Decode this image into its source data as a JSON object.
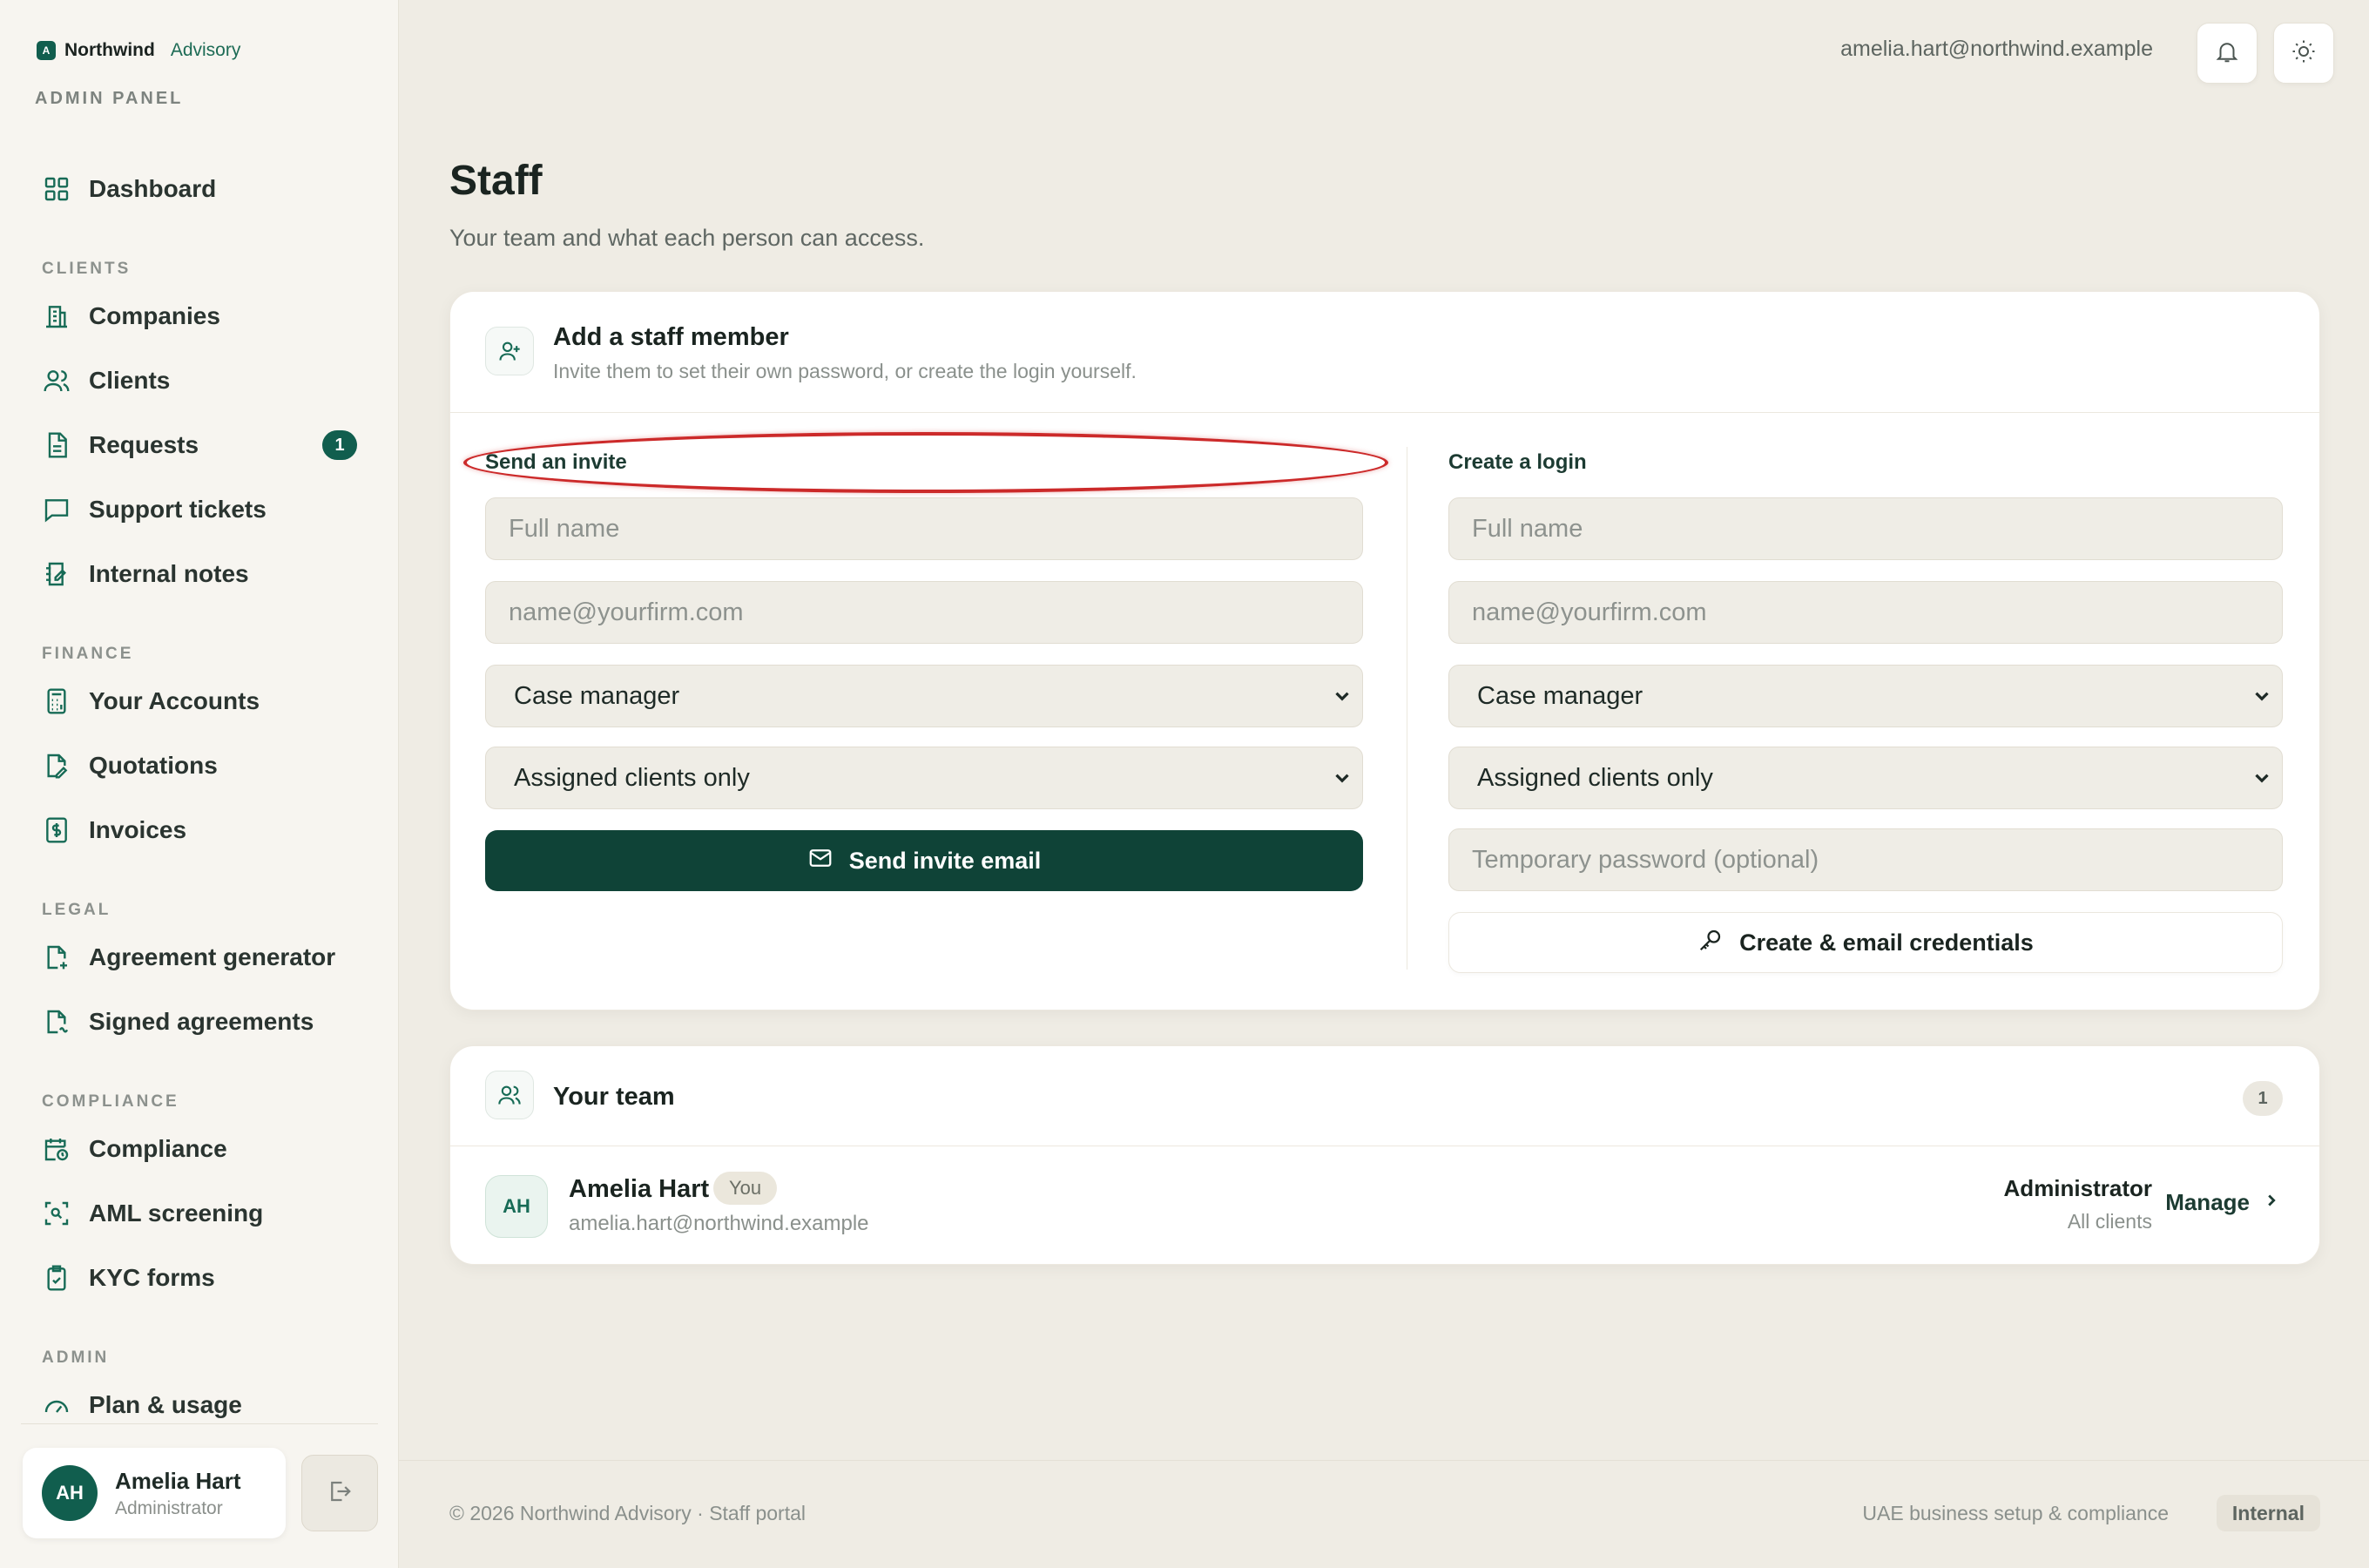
{
  "brand": {
    "mark": "A",
    "name": "Northwind",
    "sub": "Advisory",
    "panel": "ADMIN PANEL"
  },
  "nav": {
    "dashboard": "Dashboard",
    "sections": {
      "clients": "CLIENTS",
      "finance": "FINANCE",
      "legal": "LEGAL",
      "compliance": "COMPLIANCE",
      "admin": "ADMIN"
    },
    "companies": "Companies",
    "clients": "Clients",
    "requests": "Requests",
    "requests_badge": "1",
    "support": "Support tickets",
    "notes": "Internal notes",
    "accounts": "Your Accounts",
    "quotations": "Quotations",
    "invoices": "Invoices",
    "agreement_gen": "Agreement generator",
    "signed": "Signed agreements",
    "compliance": "Compliance",
    "aml": "AML screening",
    "kyc": "KYC forms",
    "plan": "Plan & usage"
  },
  "user": {
    "initials": "AH",
    "name": "Amelia Hart",
    "role": "Administrator"
  },
  "topbar": {
    "email": "amelia.hart@northwind.example"
  },
  "page": {
    "title": "Staff",
    "subtitle": "Your team and what each person can access."
  },
  "add_card": {
    "title": "Add a staff member",
    "subtitle": "Invite them to set their own password, or create the login yourself.",
    "invite": {
      "heading": "Send an invite",
      "name_placeholder": "Full name",
      "email_placeholder": "name@yourfirm.com",
      "role": "Case manager",
      "access": "Assigned clients only",
      "button": "Send invite email"
    },
    "create": {
      "heading": "Create a login",
      "name_placeholder": "Full name",
      "email_placeholder": "name@yourfirm.com",
      "role": "Case manager",
      "access": "Assigned clients only",
      "password_placeholder": "Temporary password (optional)",
      "button": "Create & email credentials"
    }
  },
  "team": {
    "title": "Your team",
    "count": "1",
    "members": [
      {
        "initials": "AH",
        "name": "Amelia Hart",
        "tag": "You",
        "email": "amelia.hart@northwind.example",
        "role": "Administrator",
        "scope": "All clients",
        "action": "Manage"
      }
    ]
  },
  "footer": {
    "left": "© 2026 Northwind Advisory · Staff portal",
    "right": "UAE business setup & compliance",
    "pill": "Internal"
  },
  "colors": {
    "accent": "#115e4e",
    "primary_button": "#0f4337",
    "annotation": "#cc2a2a",
    "background": "#efece4"
  }
}
